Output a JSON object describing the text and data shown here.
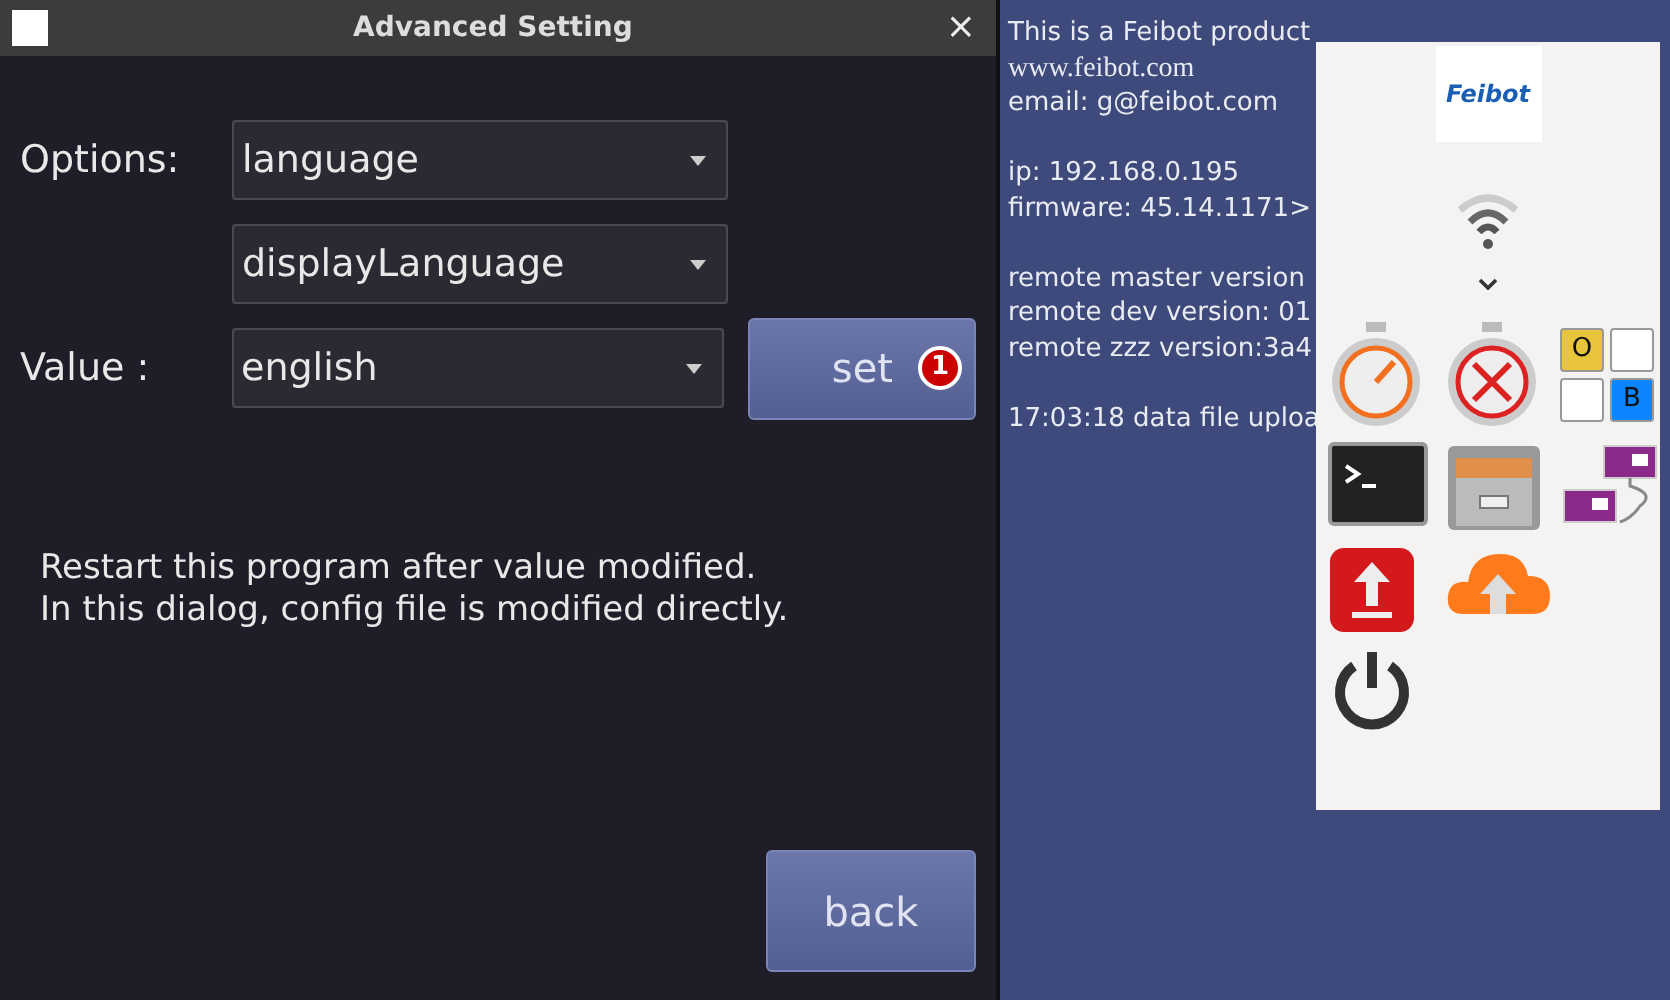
{
  "window": {
    "title": "Advanced Setting",
    "close": "×"
  },
  "form": {
    "options_label": "Options:",
    "option_selects": [
      {
        "value": "language"
      },
      {
        "value": "displayLanguage"
      }
    ],
    "value_label": "Value :",
    "value_select": {
      "value": "english"
    },
    "set_button": {
      "label": "set",
      "badge": "1"
    }
  },
  "message": [
    "Restart this program after value modified.",
    "In this dialog, config file is modified directly."
  ],
  "back_button": "back",
  "info_groups": [
    [
      {
        "text": "This is a Feibot product",
        "kind": "sans"
      },
      {
        "text": "www.feibot.com",
        "kind": "serif"
      },
      {
        "text": "email: g@feibot.com",
        "kind": "sans"
      }
    ],
    [
      {
        "text": "ip: 192.168.0.195",
        "kind": "sans"
      },
      {
        "text": "firmware: 45.14.1171>",
        "kind": "sans"
      }
    ],
    [
      {
        "text": "remote master version",
        "kind": "sans"
      },
      {
        "text": "remote dev version: 01",
        "kind": "sans"
      },
      {
        "text": "remote zzz version:3a4",
        "kind": "sans"
      }
    ],
    [
      {
        "text": "17:03:18 data file uploa",
        "kind": "sans"
      }
    ]
  ],
  "panel": {
    "logo": "Feibot",
    "indicator_cells": [
      {
        "label": "O",
        "color": "#e8c53a"
      },
      {
        "color": "#ffffff"
      },
      {
        "color": "#ffffff"
      },
      {
        "label": "B",
        "color": "#0a84ff"
      }
    ]
  }
}
